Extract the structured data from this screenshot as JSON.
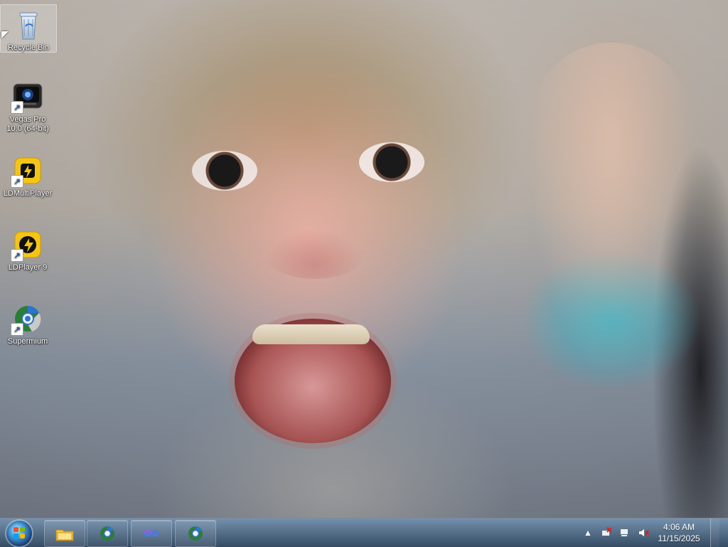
{
  "desktop": {
    "wallpaper": "photo",
    "icons": [
      {
        "label": "Recycle Bin",
        "icon": "recycle-bin-icon",
        "selected": true
      },
      {
        "label": "Vegas Pro 10.0 (64-bit)",
        "icon": "vegas-pro-icon",
        "shortcut": true
      },
      {
        "label": "LDMultiPlayer",
        "icon": "ldmultiplayer-icon",
        "shortcut": true
      },
      {
        "label": "LDPlayer 9",
        "icon": "ldplayer9-icon",
        "shortcut": true
      },
      {
        "label": "Supermium",
        "icon": "supermium-icon",
        "shortcut": true
      }
    ]
  },
  "taskbar": {
    "start_button": {
      "icon": "windows-orb-icon"
    },
    "buttons": [
      {
        "icon": "file-explorer-icon"
      },
      {
        "icon": "supermium-icon"
      },
      {
        "icon": "infinity-loop-icon"
      },
      {
        "icon": "supermium-icon"
      }
    ],
    "tray": {
      "icons": [
        "show-hidden-icons-icon",
        "network-error-icon",
        "action-center-icon",
        "volume-muted-icon"
      ],
      "time": "4:06 AM",
      "date": "11/15/2025"
    }
  },
  "colors": {
    "taskbar_top": "#7391af",
    "taskbar_bottom": "#2d465f",
    "icon_text": "#ffffff"
  }
}
